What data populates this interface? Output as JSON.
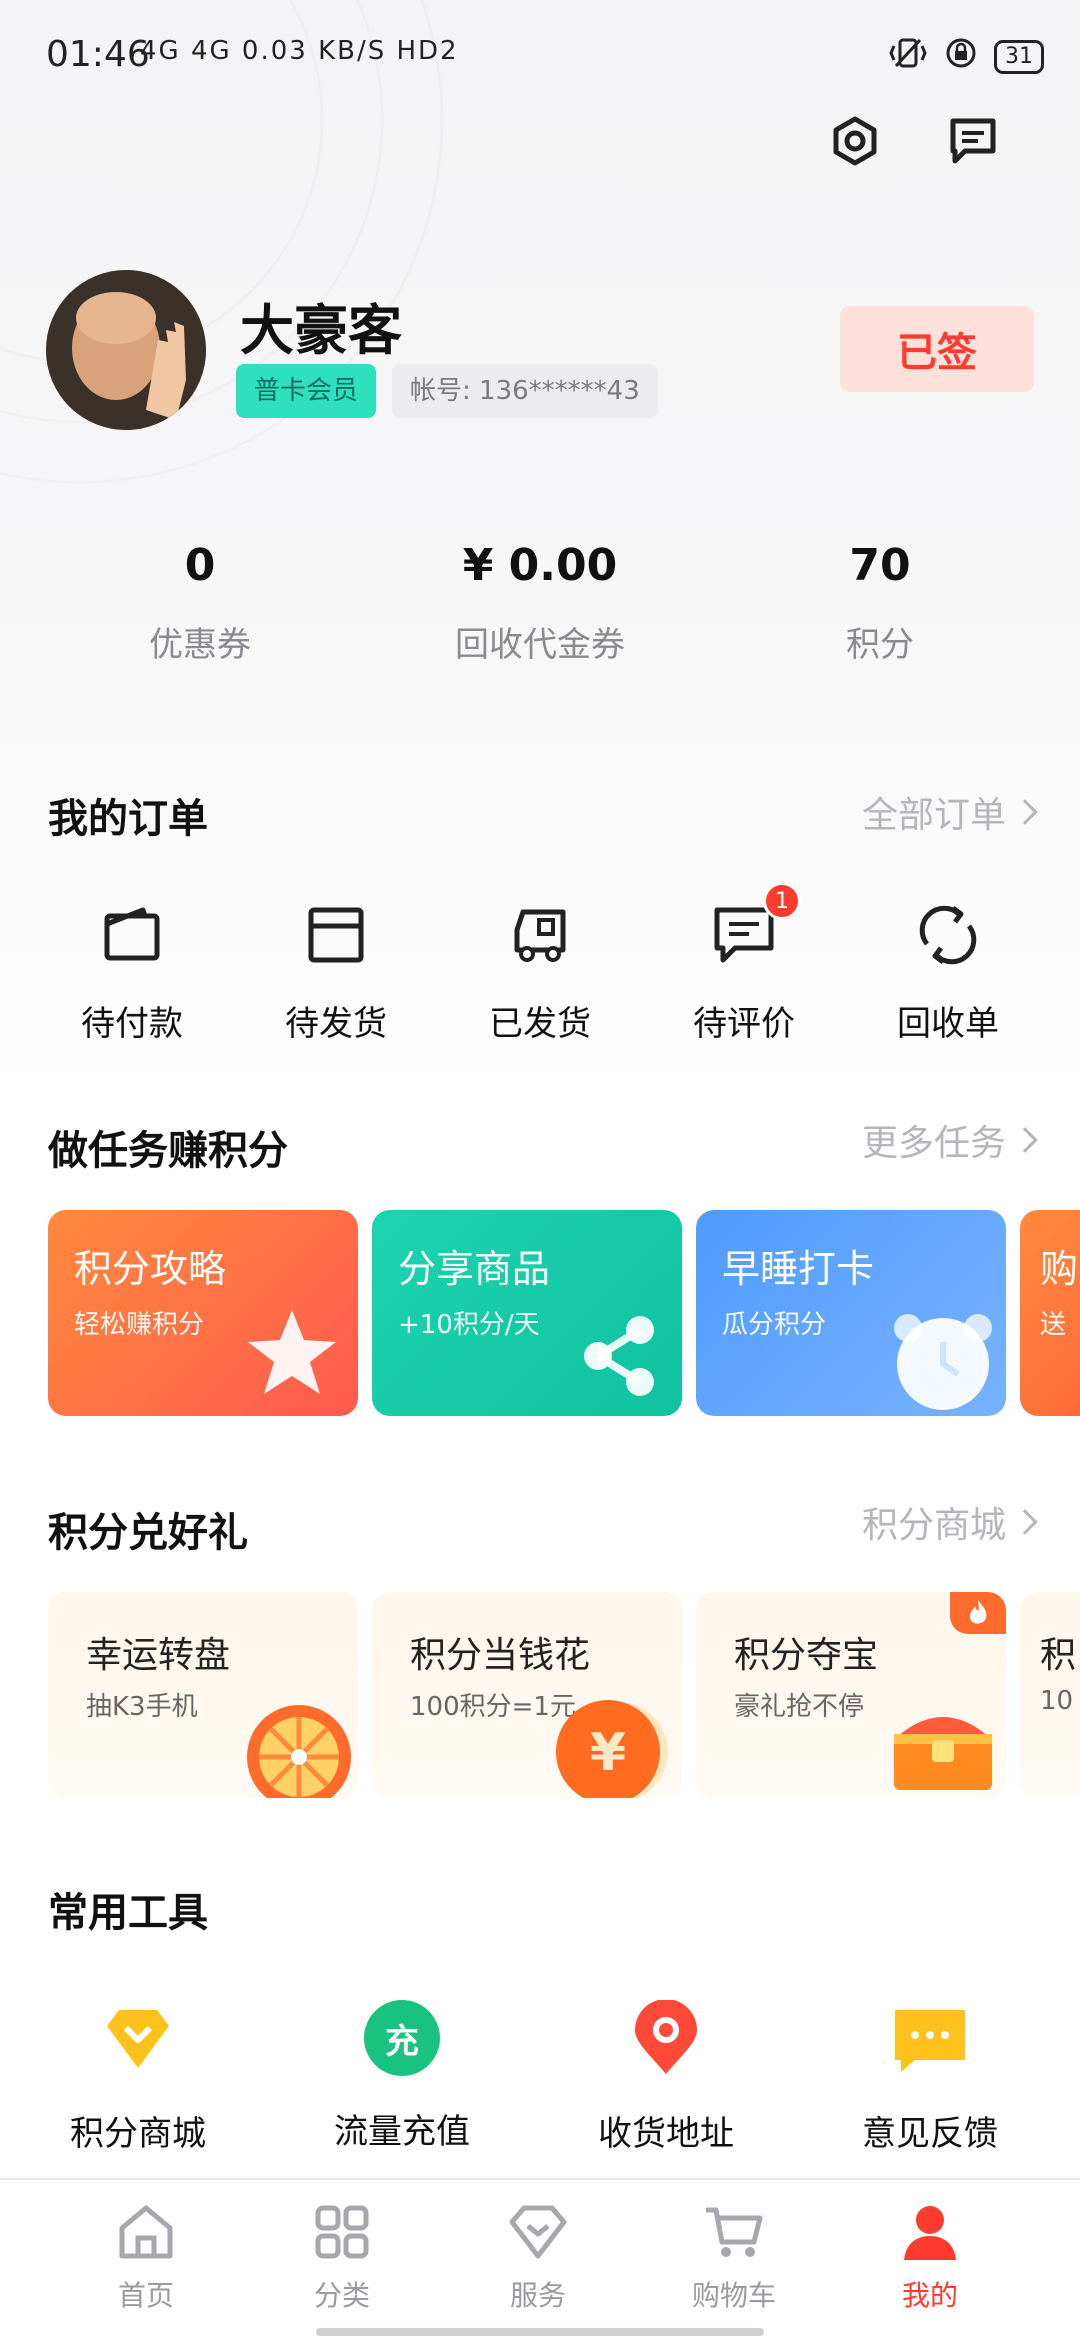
{
  "colors": {
    "accent": "#ff3b2f",
    "mint": "#2fe0bf",
    "muted_text": "#8a8a90",
    "task_orange": "#ff6b3b",
    "task_teal": "#16c8a8",
    "task_blue": "#5aa6ff"
  },
  "status_bar": {
    "time": "01:46",
    "left_icons": "4G 4G 0.03 KB/S HD2",
    "battery": "31"
  },
  "profile": {
    "username": "大豪客",
    "member_level": "普卡会员",
    "account": "帐号: 136******43",
    "checkin_label": "已签"
  },
  "stats": [
    {
      "value": "0",
      "label": "优惠券"
    },
    {
      "value": "¥ 0.00",
      "label": "回收代金券"
    },
    {
      "value": "70",
      "label": "积分"
    }
  ],
  "orders": {
    "title": "我的订单",
    "more": "全部订单",
    "items": [
      {
        "label": "待付款",
        "icon": "wallet-icon"
      },
      {
        "label": "待发货",
        "icon": "box-icon"
      },
      {
        "label": "已发货",
        "icon": "truck-icon"
      },
      {
        "label": "待评价",
        "icon": "comment-icon",
        "badge": "1"
      },
      {
        "label": "回收单",
        "icon": "recycle-icon"
      }
    ]
  },
  "tasks": {
    "title": "做任务赚积分",
    "more": "更多任务",
    "cards": [
      {
        "title": "积分攻略",
        "subtitle": "轻松赚积分",
        "icon": "star-icon"
      },
      {
        "title": "分享商品",
        "subtitle": "+10积分/天",
        "icon": "share-icon"
      },
      {
        "title": "早睡打卡",
        "subtitle": "瓜分积分",
        "icon": "alarm-clock-icon"
      },
      {
        "title": "购",
        "subtitle": "送",
        "icon": ""
      }
    ]
  },
  "gifts": {
    "title": "积分兑好礼",
    "more": "积分商城",
    "cards": [
      {
        "title": "幸运转盘",
        "subtitle": "抽K3手机",
        "icon": "wheel-icon"
      },
      {
        "title": "积分当钱花",
        "subtitle": "100积分=1元",
        "icon": "yuan-coin-icon"
      },
      {
        "title": "积分夺宝",
        "subtitle": "豪礼抢不停",
        "icon": "treasure-chest-icon"
      },
      {
        "title": "积",
        "subtitle": "10",
        "icon": ""
      }
    ]
  },
  "tools": {
    "title": "常用工具",
    "items": [
      {
        "label": "积分商城",
        "icon": "points-mall-icon"
      },
      {
        "label": "流量充值",
        "icon": "recharge-icon",
        "glyph": "充"
      },
      {
        "label": "收货地址",
        "icon": "location-pin-icon"
      },
      {
        "label": "意见反馈",
        "icon": "feedback-icon",
        "glyph": "···"
      }
    ]
  },
  "bottom_nav": {
    "items": [
      {
        "label": "首页",
        "icon": "home-icon",
        "active": false
      },
      {
        "label": "分类",
        "icon": "grid-icon",
        "active": false
      },
      {
        "label": "服务",
        "icon": "service-icon",
        "active": false
      },
      {
        "label": "购物车",
        "icon": "cart-icon",
        "active": false
      },
      {
        "label": "我的",
        "icon": "user-icon",
        "active": true
      }
    ]
  }
}
